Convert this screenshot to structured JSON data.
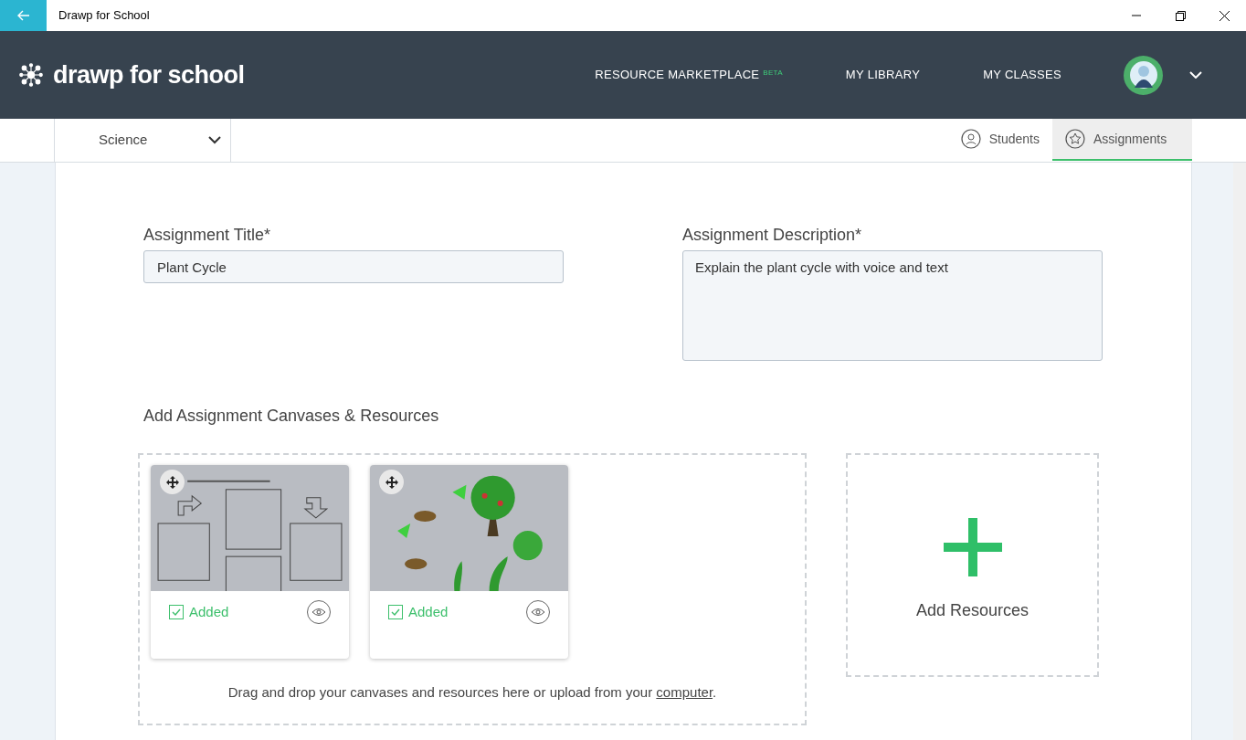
{
  "window": {
    "title": "Drawp for School"
  },
  "header": {
    "logo": "drawp for school",
    "nav": [
      {
        "label": "RESOURCE MARKETPLACE",
        "badge": "BETA"
      },
      {
        "label": "MY LIBRARY"
      },
      {
        "label": "MY CLASSES"
      }
    ]
  },
  "class_selector": {
    "value": "Science"
  },
  "tabs": [
    {
      "label": "Students",
      "kind": "person",
      "selected": false
    },
    {
      "label": "Assignments",
      "kind": "star",
      "selected": true
    }
  ],
  "form": {
    "title_label": "Assignment Title*",
    "title_value": "Plant Cycle",
    "description_label": "Assignment Description*",
    "description_value": "Explain the plant cycle with voice and text"
  },
  "resources_heading": "Add Assignment Canvases & Resources",
  "resources": [
    {
      "kind": "picture",
      "status": "Added",
      "checked": true
    },
    {
      "kind": "picture",
      "status": "Added",
      "checked": true
    }
  ],
  "drop_hint": {
    "text": "Drag and drop your canvases and resources here or upload from your",
    "link": "computer",
    "end": "."
  },
  "add_button": "Add Resources"
}
